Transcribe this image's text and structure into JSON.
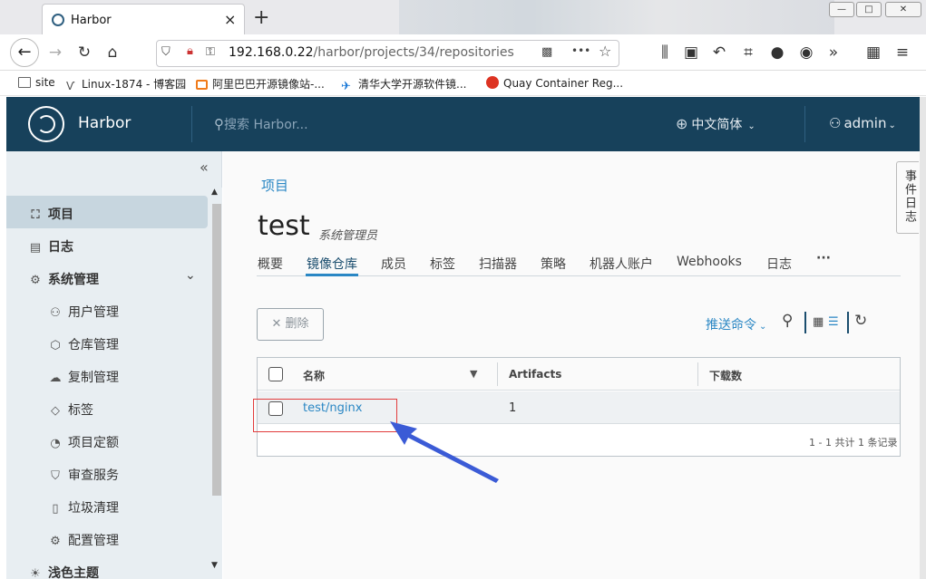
{
  "browser": {
    "tab_title": "Harbor",
    "tab_close": "×",
    "new_tab": "+",
    "url_host": "192.168.0.22",
    "url_path": "/harbor/projects/34/repositories",
    "url_more": "•••",
    "bookmarks": [
      {
        "label": "site",
        "icon": "folder-icon"
      },
      {
        "label": "Linux-1874 - 博客园",
        "icon": "cnblogs-icon"
      },
      {
        "label": "阿里巴巴开源镜像站-...",
        "icon": "aliyun-icon"
      },
      {
        "label": "清华大学开源软件镜...",
        "icon": "tuna-icon"
      },
      {
        "label": "Quay Container Reg...",
        "icon": "quay-icon"
      }
    ]
  },
  "header": {
    "brand": "Harbor",
    "search_placeholder": "搜索 Harbor...",
    "language": "中文简体",
    "user": "admin"
  },
  "sidebar": {
    "items": [
      {
        "label": "项目",
        "icon": "projects-icon"
      },
      {
        "label": "日志",
        "icon": "logs-icon"
      },
      {
        "label": "系统管理",
        "icon": "admin-icon"
      },
      {
        "label": "用户管理",
        "icon": "users-icon"
      },
      {
        "label": "仓库管理",
        "icon": "registry-icon"
      },
      {
        "label": "复制管理",
        "icon": "replication-icon"
      },
      {
        "label": "标签",
        "icon": "label-icon"
      },
      {
        "label": "项目定额",
        "icon": "quota-icon"
      },
      {
        "label": "审查服务",
        "icon": "interrogation-icon"
      },
      {
        "label": "垃圾清理",
        "icon": "gc-icon"
      },
      {
        "label": "配置管理",
        "icon": "config-icon"
      },
      {
        "label": "浅色主题",
        "icon": "theme-icon"
      }
    ]
  },
  "event_tab": "事件日志",
  "main": {
    "breadcrumb": "项目",
    "project_name": "test",
    "project_role": "系统管理员",
    "tabs": [
      "概要",
      "镜像仓库",
      "成员",
      "标签",
      "扫描器",
      "策略",
      "机器人账户",
      "Webhooks",
      "日志",
      "···"
    ],
    "active_tab": "镜像仓库",
    "delete_label": "删除",
    "push_command": "推送命令",
    "table": {
      "columns": [
        "名称",
        "Artifacts",
        "下载数"
      ],
      "rows": [
        {
          "name": "test/nginx",
          "artifacts": "1",
          "pulls": ""
        }
      ],
      "footer": "1 - 1 共计 1 条记录"
    }
  },
  "colors": {
    "header": "#17415b",
    "accent": "#2a87c4",
    "highlight": "#e23c3c",
    "arrow": "#3b5bd6"
  }
}
